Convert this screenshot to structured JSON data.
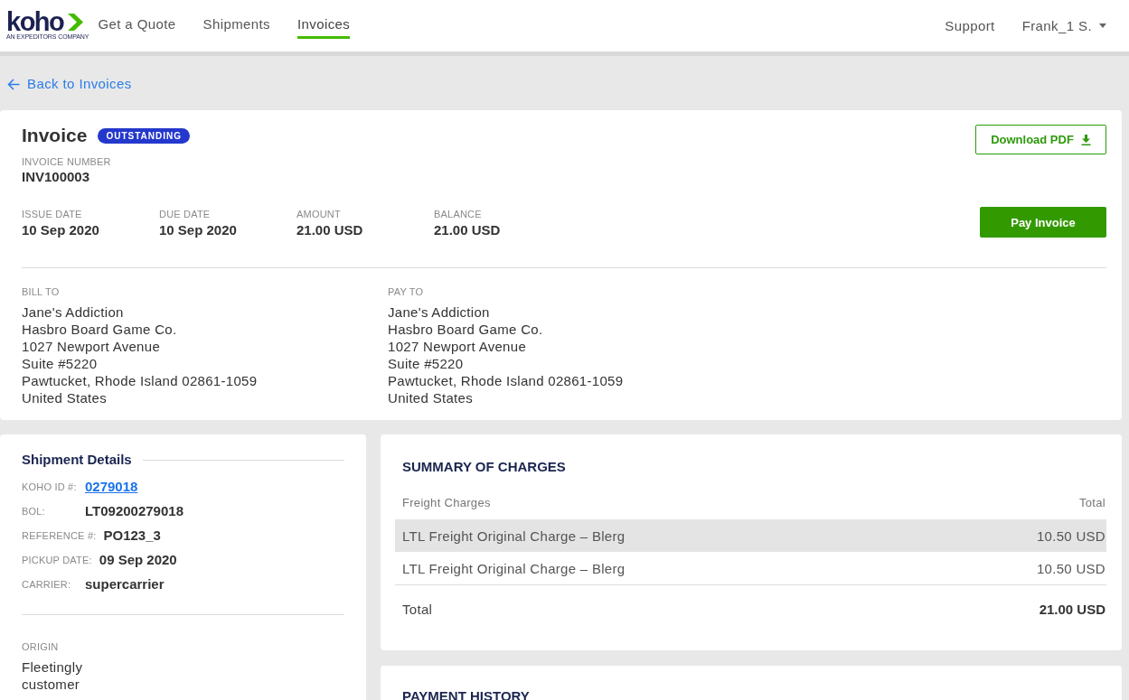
{
  "nav": {
    "logo": {
      "wordmark": "koho",
      "tagline": "AN EXPEDITORS COMPANY"
    },
    "links": [
      {
        "label": "Get a Quote",
        "selected": false
      },
      {
        "label": "Shipments",
        "selected": false
      },
      {
        "label": "Invoices",
        "selected": true
      }
    ],
    "support": "Support",
    "user": "Frank_1 S."
  },
  "back_link": "Back to Invoices",
  "invoice": {
    "title": "Invoice",
    "status": "OUTSTANDING",
    "number_label": "INVOICE NUMBER",
    "number": "INV100003",
    "facts": [
      {
        "label": "ISSUE DATE",
        "value": "10 Sep 2020"
      },
      {
        "label": "DUE DATE",
        "value": "10 Sep 2020"
      },
      {
        "label": "AMOUNT",
        "value": "21.00 USD"
      },
      {
        "label": "BALANCE",
        "value": "21.00 USD"
      }
    ],
    "download_button": "Download PDF",
    "pay_button": "Pay Invoice",
    "parties": [
      {
        "label": "BILL TO",
        "lines": [
          "Jane's Addiction",
          "Hasbro Board Game Co.",
          "1027 Newport Avenue",
          "Suite #5220",
          "Pawtucket, Rhode Island 02861-1059",
          "United States"
        ]
      },
      {
        "label": "PAY TO",
        "lines": [
          "Jane's Addiction",
          "Hasbro Board Game Co.",
          "1027 Newport Avenue",
          "Suite #5220",
          "Pawtucket, Rhode Island 02861-1059",
          "United States"
        ]
      }
    ]
  },
  "shipment_details": {
    "title": "Shipment Details",
    "fields": [
      {
        "label": "KOHO ID #:",
        "value": "0279018",
        "kind": "link"
      },
      {
        "label": "BOL:",
        "value": "LT09200279018",
        "kind": "text"
      },
      {
        "label": "REFERENCE #:",
        "value": "PO123_3",
        "kind": "text"
      },
      {
        "label": "PICKUP DATE:",
        "value": "09 Sep 2020",
        "kind": "text"
      },
      {
        "label": "CARRIER:",
        "value": "supercarrier",
        "kind": "text"
      }
    ],
    "origin": {
      "label": "ORIGIN",
      "lines": [
        "Fleetingly",
        "customer"
      ]
    }
  },
  "summary": {
    "title": "SUMMARY OF CHARGES",
    "columns": [
      "Freight Charges",
      "Total"
    ],
    "rows": [
      {
        "description": "LTL Freight Original Charge – Blerg",
        "amount": "10.50 USD",
        "highlighted": true
      },
      {
        "description": "LTL Freight Original Charge – Blerg",
        "amount": "10.50 USD",
        "highlighted": false
      }
    ],
    "total": {
      "label": "Total",
      "amount": "21.00 USD"
    }
  },
  "payment_history": {
    "title": "PAYMENT HISTORY"
  }
}
